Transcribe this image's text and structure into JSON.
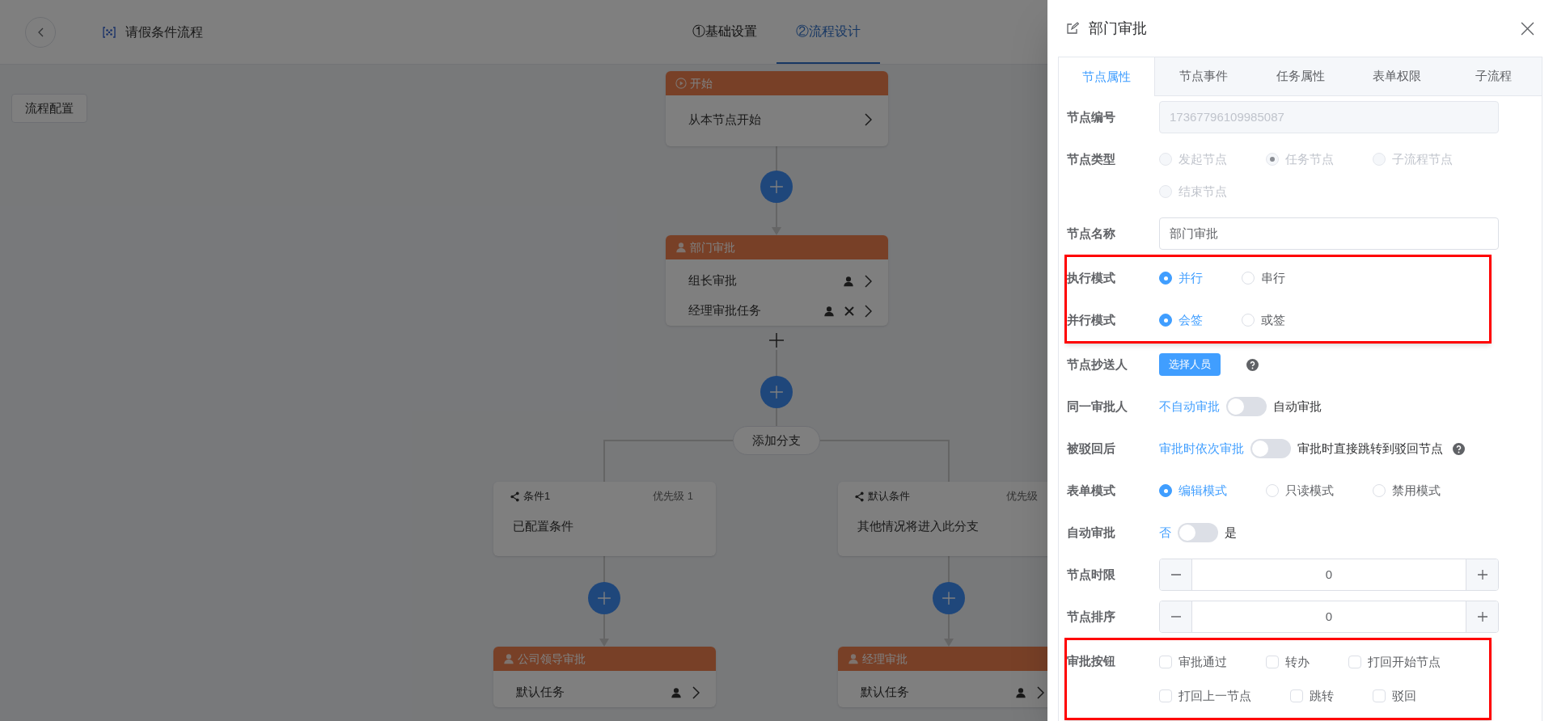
{
  "header": {
    "title": "请假条件流程",
    "steps": [
      {
        "label": "①基础设置",
        "selected": false
      },
      {
        "label": "②流程设计",
        "selected": true
      }
    ]
  },
  "config_button": "流程配置",
  "flow": {
    "start": {
      "title": "开始",
      "text": "从本节点开始"
    },
    "approval": {
      "title": "部门审批",
      "tasks": [
        {
          "name": "组长审批",
          "removable": false
        },
        {
          "name": "经理审批任务",
          "removable": true
        }
      ]
    },
    "branch_button": "添加分支",
    "branches": [
      {
        "condition": {
          "title": "条件1",
          "priority": "优先级 1",
          "text": "已配置条件"
        },
        "approval": {
          "title": "公司领导审批",
          "tasks": [
            {
              "name": "默认任务",
              "removable": false
            }
          ]
        }
      },
      {
        "condition": {
          "title": "默认条件",
          "priority": "优先级",
          "text": "其他情况将进入此分支"
        },
        "approval": {
          "title": "经理审批",
          "tasks": [
            {
              "name": "默认任务",
              "removable": false
            }
          ]
        }
      }
    ]
  },
  "drawer": {
    "title": "部门审批",
    "tabs": [
      {
        "label": "节点属性",
        "selected": true
      },
      {
        "label": "节点事件",
        "selected": false
      },
      {
        "label": "任务属性",
        "selected": false
      },
      {
        "label": "表单权限",
        "selected": false
      },
      {
        "label": "子流程",
        "selected": false
      }
    ],
    "sections": [
      {
        "highlighted": false,
        "rows": [
          {
            "kind": "readonly",
            "label": "节点编号",
            "value": "17367796109985087"
          },
          {
            "kind": "radio",
            "label": "节点类型",
            "options": [
              {
                "label": "发起节点",
                "selected": false,
                "disabled": true
              },
              {
                "label": "任务节点",
                "selected": true,
                "disabled": true
              },
              {
                "label": "子流程节点",
                "selected": false,
                "disabled": true
              },
              {
                "label": "结束节点",
                "selected": false,
                "disabled": true
              }
            ]
          },
          {
            "kind": "input",
            "label": "节点名称",
            "value": "部门审批"
          }
        ]
      },
      {
        "highlighted": true,
        "rows": [
          {
            "kind": "radio",
            "label": "执行模式",
            "options": [
              {
                "label": "并行",
                "selected": true,
                "disabled": false
              },
              {
                "label": "串行",
                "selected": false,
                "disabled": false
              }
            ]
          },
          {
            "kind": "radio",
            "label": "并行模式",
            "options": [
              {
                "label": "会签",
                "selected": true,
                "disabled": false
              },
              {
                "label": "或签",
                "selected": false,
                "disabled": false
              }
            ]
          }
        ]
      },
      {
        "highlighted": false,
        "rows": [
          {
            "kind": "button",
            "label": "节点抄送人",
            "button": "选择人员",
            "help": true
          },
          {
            "kind": "switch",
            "label": "同一审批人",
            "off_label": "不自动审批",
            "on_label": "自动审批",
            "on": false,
            "help": false
          },
          {
            "kind": "switch",
            "label": "被驳回后",
            "off_label": "审批时依次审批",
            "on_label": "审批时直接跳转到驳回节点",
            "on": false,
            "help": true
          },
          {
            "kind": "radio",
            "label": "表单模式",
            "options": [
              {
                "label": "编辑模式",
                "selected": true,
                "disabled": false
              },
              {
                "label": "只读模式",
                "selected": false,
                "disabled": false
              },
              {
                "label": "禁用模式",
                "selected": false,
                "disabled": false
              }
            ]
          },
          {
            "kind": "switch",
            "label": "自动审批",
            "off_label": "否",
            "on_label": "是",
            "on": false,
            "help": false
          },
          {
            "kind": "number",
            "label": "节点时限",
            "value": "0"
          },
          {
            "kind": "number",
            "label": "节点排序",
            "value": "0"
          }
        ]
      },
      {
        "highlighted": true,
        "rows": [
          {
            "kind": "checkbox",
            "label": "审批按钮",
            "options": [
              {
                "label": "审批通过",
                "checked": false
              },
              {
                "label": "转办",
                "checked": false
              },
              {
                "label": "打回开始节点",
                "checked": false
              },
              {
                "label": "打回上一节点",
                "checked": false
              },
              {
                "label": "跳转",
                "checked": false
              },
              {
                "label": "驳回",
                "checked": false
              }
            ]
          }
        ]
      }
    ]
  }
}
